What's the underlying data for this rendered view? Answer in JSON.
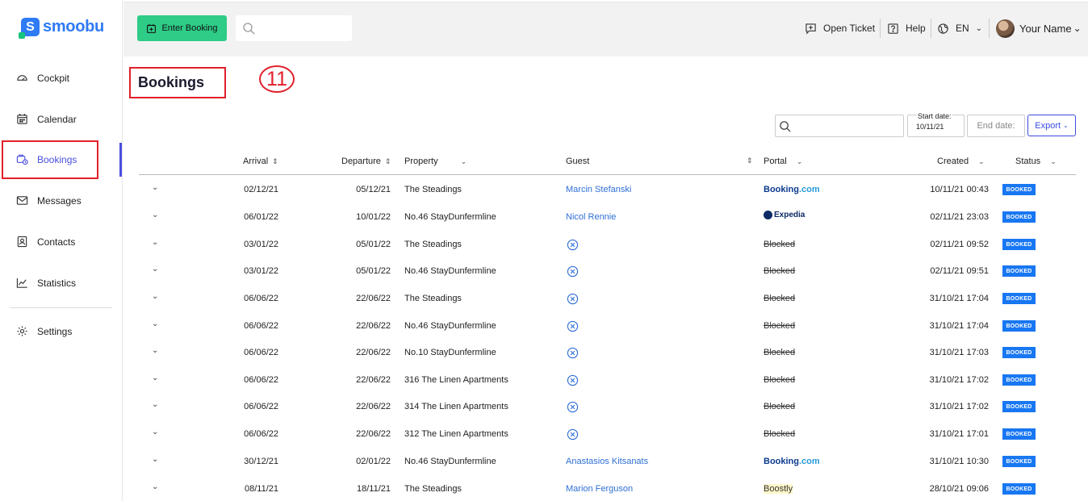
{
  "brand": {
    "name": "smoobu",
    "mark": "S"
  },
  "sidebar": {
    "items": [
      {
        "label": "Cockpit",
        "icon": "gauge-icon"
      },
      {
        "label": "Calendar",
        "icon": "calendar-icon"
      },
      {
        "label": "Bookings",
        "icon": "bookings-icon"
      },
      {
        "label": "Messages",
        "icon": "envelope-icon"
      },
      {
        "label": "Contacts",
        "icon": "contact-card-icon"
      },
      {
        "label": "Statistics",
        "icon": "chart-icon"
      },
      {
        "label": "Settings",
        "icon": "gear-icon"
      }
    ]
  },
  "topbar": {
    "enter_booking": "Enter Booking",
    "search_placeholder": "",
    "open_ticket": "Open Ticket",
    "help": "Help",
    "language": "EN",
    "user_name": "Your Name"
  },
  "page": {
    "title": "Bookings",
    "step_badge": "11"
  },
  "filters": {
    "search_placeholder": "",
    "start_date_label": "Start date:",
    "start_date_value": "10/11/21",
    "end_date_placeholder": "End date:",
    "export_label": "Export"
  },
  "table": {
    "columns": {
      "arrival": "Arrival",
      "departure": "Departure",
      "property": "Property",
      "guest": "Guest",
      "portal": "Portal",
      "created": "Created",
      "status": "Status"
    },
    "rows": [
      {
        "arrival": "02/12/21",
        "departure": "05/12/21",
        "property": "The Steadings",
        "guest": "Marcin Stefanski",
        "portal": "Booking.com",
        "created": "10/11/21 00:43",
        "status": "BOOKED"
      },
      {
        "arrival": "06/01/22",
        "departure": "10/01/22",
        "property": "No.46 StayDunfermline",
        "guest": "Nicol Rennie",
        "portal": "Expedia",
        "created": "02/11/21 23:03",
        "status": "BOOKED"
      },
      {
        "arrival": "03/01/22",
        "departure": "05/01/22",
        "property": "The Steadings",
        "guest": "",
        "portal": "Blocked",
        "created": "02/11/21 09:52",
        "status": "BOOKED"
      },
      {
        "arrival": "03/01/22",
        "departure": "05/01/22",
        "property": "No.46 StayDunfermline",
        "guest": "",
        "portal": "Blocked",
        "created": "02/11/21 09:51",
        "status": "BOOKED"
      },
      {
        "arrival": "06/06/22",
        "departure": "22/06/22",
        "property": "The Steadings",
        "guest": "",
        "portal": "Blocked",
        "created": "31/10/21 17:04",
        "status": "BOOKED"
      },
      {
        "arrival": "06/06/22",
        "departure": "22/06/22",
        "property": "No.46 StayDunfermline",
        "guest": "",
        "portal": "Blocked",
        "created": "31/10/21 17:04",
        "status": "BOOKED"
      },
      {
        "arrival": "06/06/22",
        "departure": "22/06/22",
        "property": "No.10 StayDunfermline",
        "guest": "",
        "portal": "Blocked",
        "created": "31/10/21 17:03",
        "status": "BOOKED"
      },
      {
        "arrival": "06/06/22",
        "departure": "22/06/22",
        "property": "316 The Linen Apartments",
        "guest": "",
        "portal": "Blocked",
        "created": "31/10/21 17:02",
        "status": "BOOKED"
      },
      {
        "arrival": "06/06/22",
        "departure": "22/06/22",
        "property": "314 The Linen Apartments",
        "guest": "",
        "portal": "Blocked",
        "created": "31/10/21 17:02",
        "status": "BOOKED"
      },
      {
        "arrival": "06/06/22",
        "departure": "22/06/22",
        "property": "312 The Linen Apartments",
        "guest": "",
        "portal": "Blocked",
        "created": "31/10/21 17:01",
        "status": "BOOKED"
      },
      {
        "arrival": "30/12/21",
        "departure": "02/01/22",
        "property": "No.46 StayDunfermline",
        "guest": "Anastasios Kitsanats",
        "portal": "Booking.com",
        "created": "31/10/21 10:30",
        "status": "BOOKED"
      },
      {
        "arrival": "08/11/21",
        "departure": "18/11/21",
        "property": "The Steadings",
        "guest": "Marion Ferguson",
        "portal": "Boostly",
        "created": "28/10/21 09:06",
        "status": "BOOKED"
      }
    ]
  }
}
